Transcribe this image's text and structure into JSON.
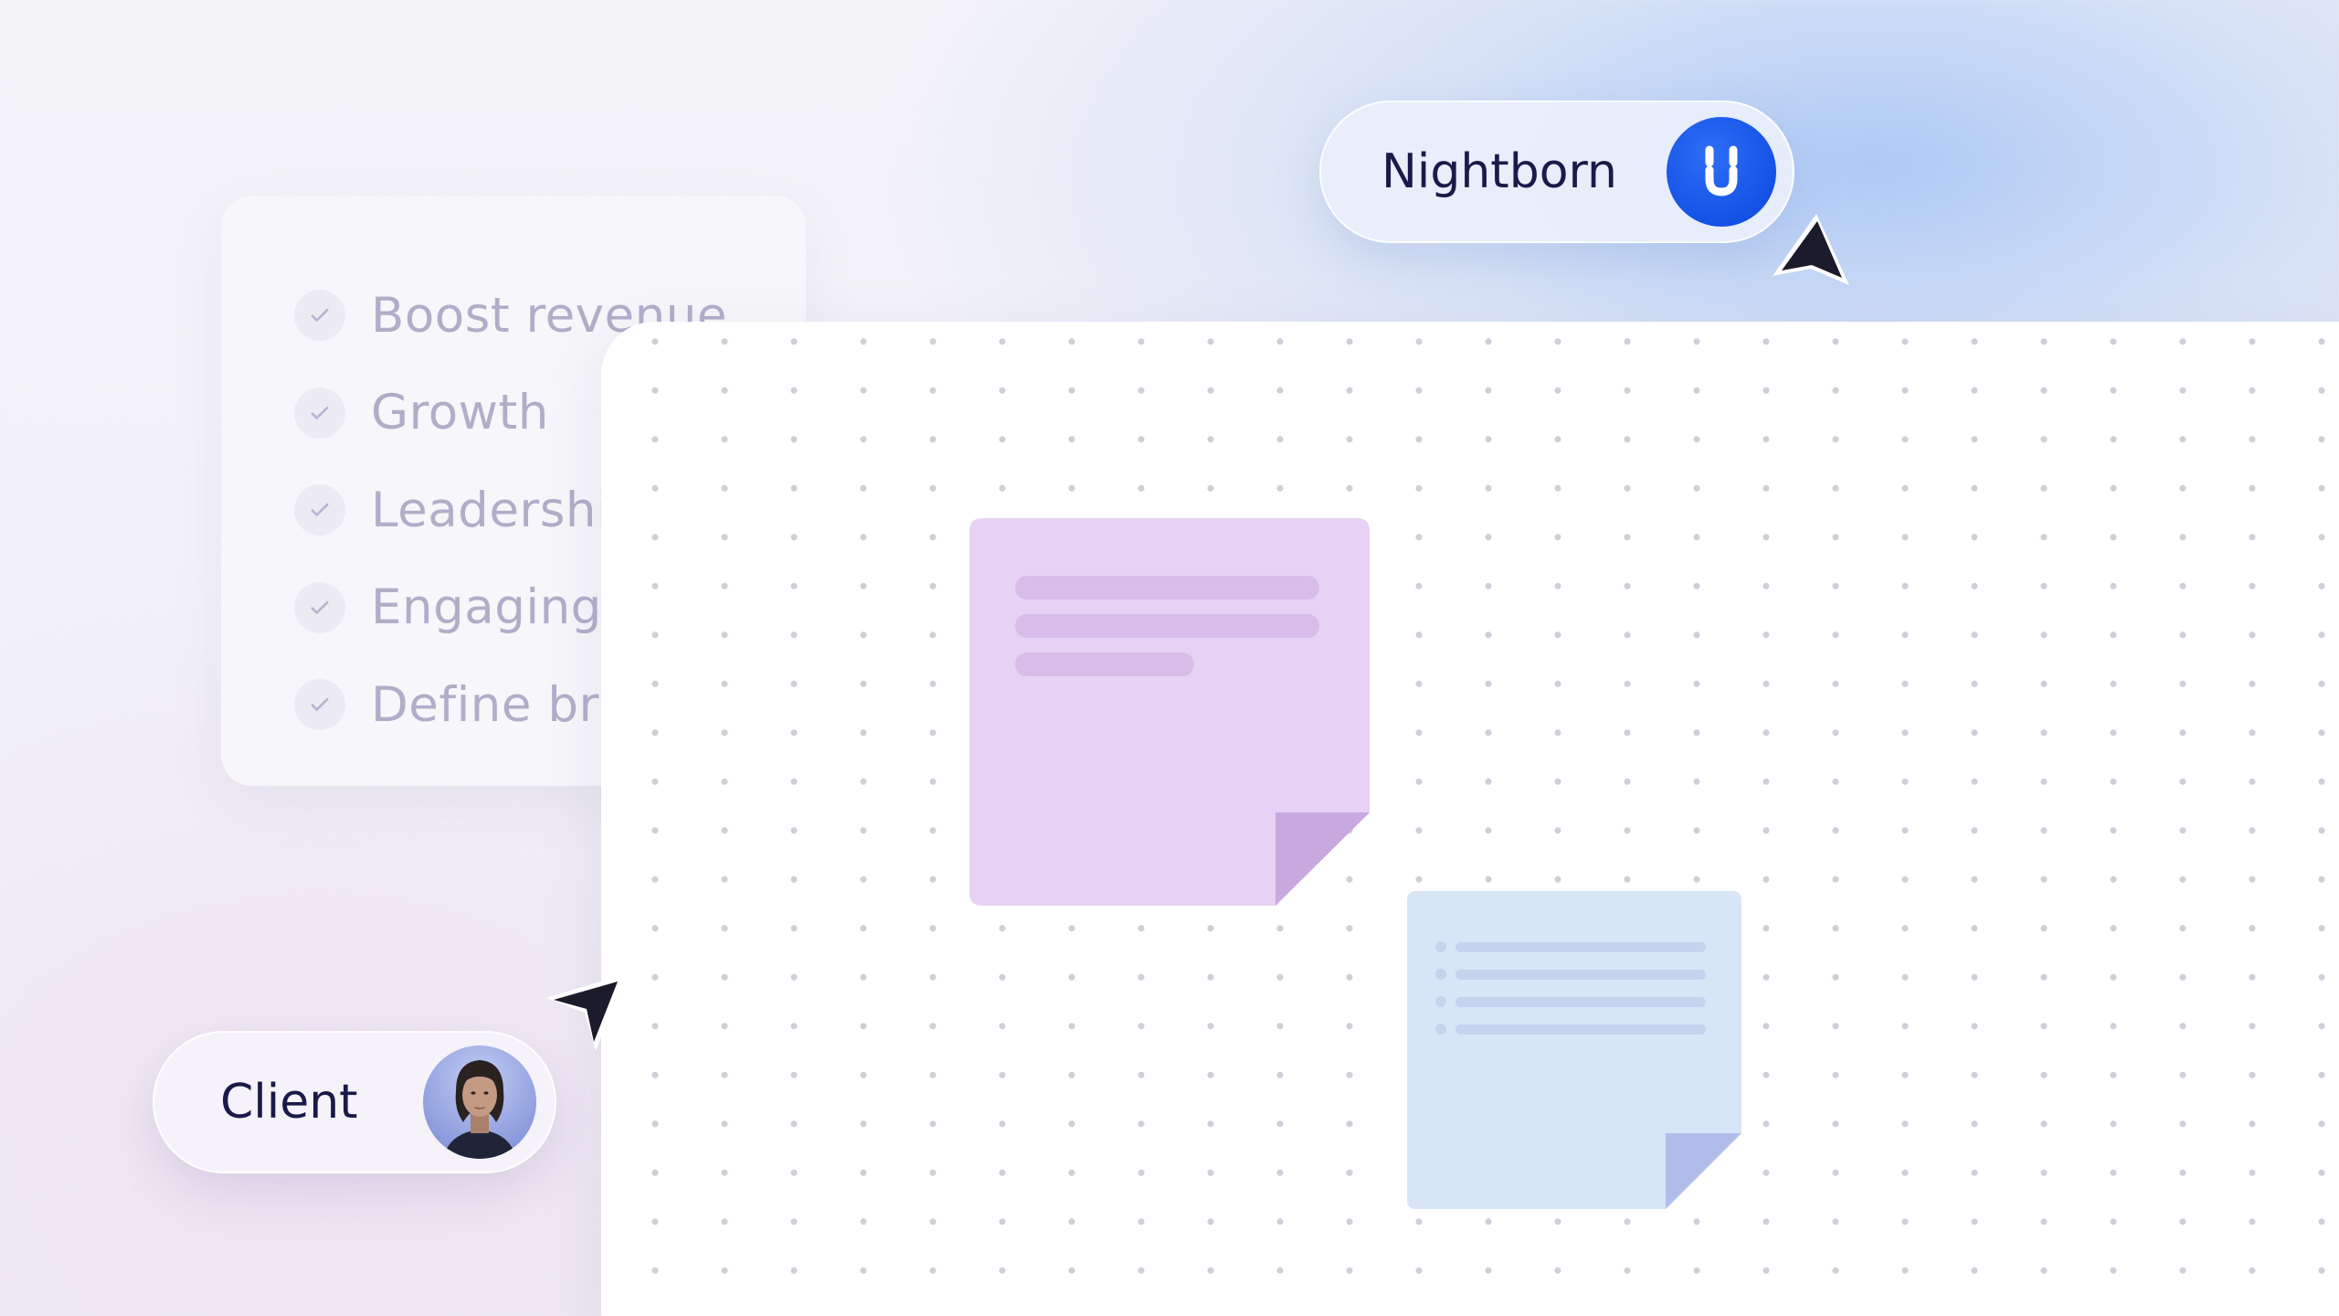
{
  "checklist": {
    "items": [
      {
        "label": "Boost revenue",
        "checked": true
      },
      {
        "label": "Growth",
        "checked": true
      },
      {
        "label": "Leadership",
        "checked": true
      },
      {
        "label": "Engaging",
        "checked": true
      },
      {
        "label": "Define brand",
        "checked": true
      }
    ],
    "check_icon": "check-icon"
  },
  "collaborators": [
    {
      "name": "Nightborn",
      "badge_icon": "nightborn-logo-icon",
      "badge_color": "#1452e6"
    },
    {
      "name": "Client",
      "badge_icon": "avatar"
    }
  ],
  "sticky_notes": [
    {
      "color": "#e6d2f5",
      "fold_color": "#c9a8e0",
      "style": "text-lines"
    },
    {
      "color": "#d7e5f7",
      "fold_color": "#b2bdeb",
      "style": "bullet-list"
    }
  ],
  "colors": {
    "background": "#efeef6",
    "board": "#ffffff",
    "accent_blue": "#1452e6",
    "text_dark": "#1a1a4a",
    "checklist_text": "#b1adc9"
  }
}
